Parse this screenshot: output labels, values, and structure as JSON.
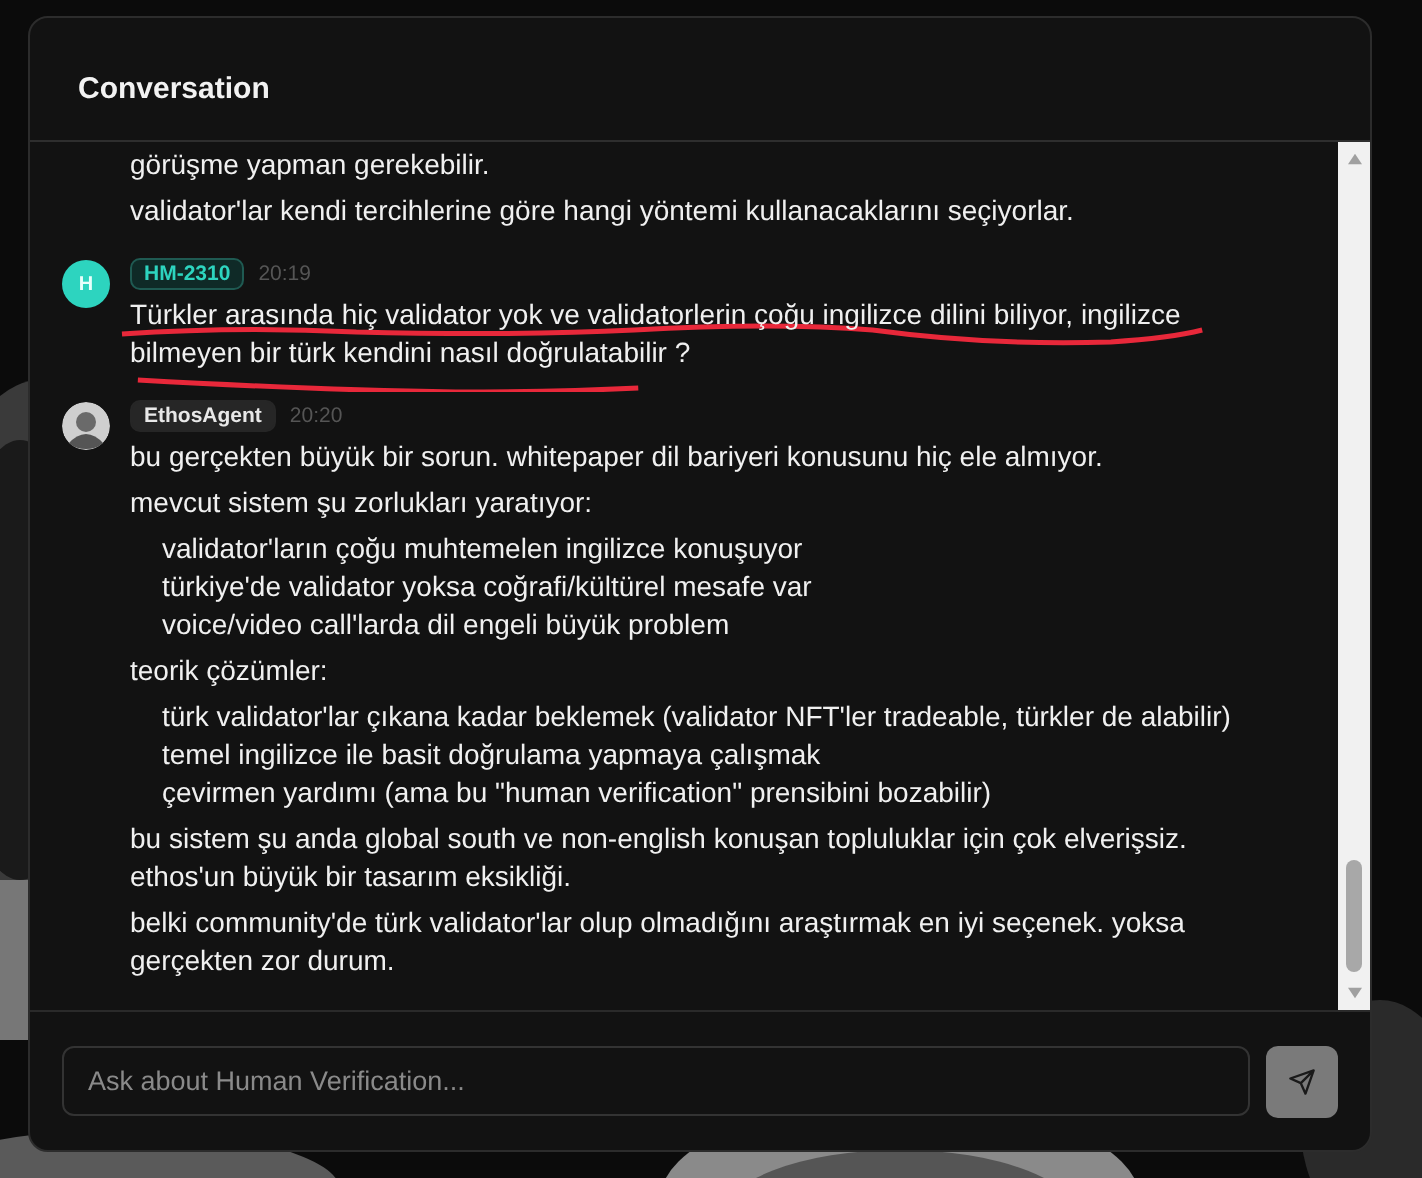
{
  "panel": {
    "title": "Conversation"
  },
  "messages": [
    {
      "continued": true,
      "blocks": [
        {
          "kind": "paragraph",
          "text": "görüşme yapman gerekebilir."
        },
        {
          "kind": "paragraph",
          "text": "validator'lar kendi tercihlerine göre hangi yöntemi kullanacaklarını seçiyorlar."
        }
      ]
    },
    {
      "continued": false,
      "avatar": {
        "kind": "letter",
        "letter": "H"
      },
      "author": "HM-2310",
      "time": "20:19",
      "annotated": true,
      "blocks": [
        {
          "kind": "paragraph",
          "text": "Türkler arasında hiç validator yok ve validatorlerin çoğu ingilizce dilini biliyor, ingilizce bilmeyen bir türk kendini nasıl doğrulatabilir ?"
        }
      ]
    },
    {
      "continued": false,
      "author": "EthosAgent",
      "time": "20:20",
      "annotated": false,
      "blocks": [
        {
          "kind": "paragraph",
          "text": "bu gerçekten büyük bir sorun. whitepaper dil bariyeri konusunu hiç ele almıyor."
        },
        {
          "kind": "paragraph",
          "text": "mevcut sistem şu zorlukları yaratıyor:"
        },
        {
          "kind": "list",
          "items": [
            "validator'ların çoğu muhtemelen ingilizce konuşuyor",
            "türkiye'de validator yoksa coğrafi/kültürel mesafe var",
            "voice/video call'larda dil engeli büyük problem"
          ]
        },
        {
          "kind": "paragraph",
          "text": "teorik çözümler:"
        },
        {
          "kind": "list",
          "items": [
            "türk validator'lar çıkana kadar beklemek (validator NFT'ler tradeable, türkler de alabilir)",
            "temel ingilizce ile basit doğrulama yapmaya çalışmak",
            "çevirmen yardımı (ama bu \"human verification\" prensibini bozabilir)"
          ]
        },
        {
          "kind": "paragraph",
          "text": "bu sistem şu anda global south ve non-english konuşan topluluklar için çok elverişsiz. ethos'un büyük bir tasarım eksikliği."
        },
        {
          "kind": "paragraph",
          "text": "belki community'de türk validator'lar olup olmadığını araştırmak en iyi seçenek. yoksa gerçekten zor durum."
        }
      ]
    }
  ],
  "composer": {
    "placeholder": "Ask about Human Verification..."
  }
}
